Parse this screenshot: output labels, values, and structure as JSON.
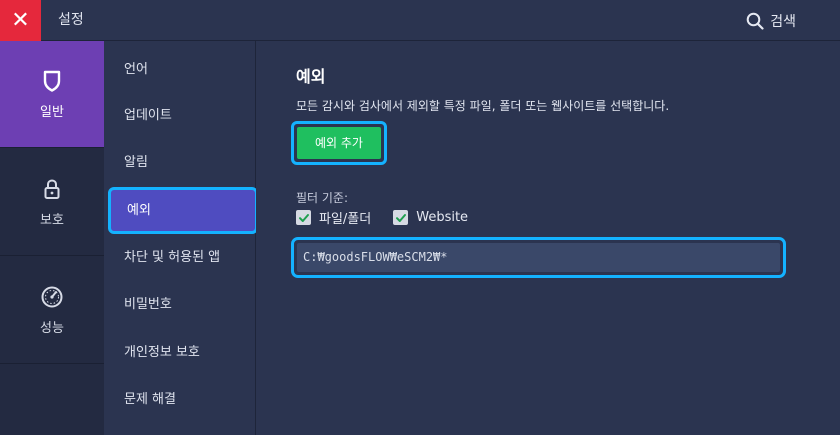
{
  "window": {
    "close_label": "✕",
    "title": "설정",
    "search_label": "검색"
  },
  "categories": [
    {
      "label": "일반",
      "icon": "shield-icon",
      "active": true
    },
    {
      "label": "보호",
      "icon": "lock-icon",
      "active": false
    },
    {
      "label": "성능",
      "icon": "speedometer-icon",
      "active": false
    }
  ],
  "nav": [
    {
      "label": "언어"
    },
    {
      "label": "업데이트"
    },
    {
      "label": "알림"
    },
    {
      "label": "예외",
      "active": true
    },
    {
      "label": "차단 및 허용된 앱"
    },
    {
      "label": "비밀번호"
    },
    {
      "label": "개인정보 보호"
    },
    {
      "label": "문제 해결"
    }
  ],
  "main": {
    "section_title": "예외",
    "description": "모든 감시와 검사에서 제외할 특정 파일, 폴더 또는 웹사이트를 선택합니다.",
    "add_button": "예외 추가",
    "filter_label": "필터 기준:",
    "filters": [
      {
        "label": "파일/폴더",
        "checked": true
      },
      {
        "label": "Website",
        "checked": true
      }
    ],
    "exception_path": "C:₩goodsFLOW₩eSCM2₩*"
  },
  "colors": {
    "accent_purple": "#6d3fb3",
    "nav_active": "#4f4cc0",
    "add_button": "#1fbf5f",
    "close_red": "#e5283c",
    "highlight": "#14b2ff"
  }
}
